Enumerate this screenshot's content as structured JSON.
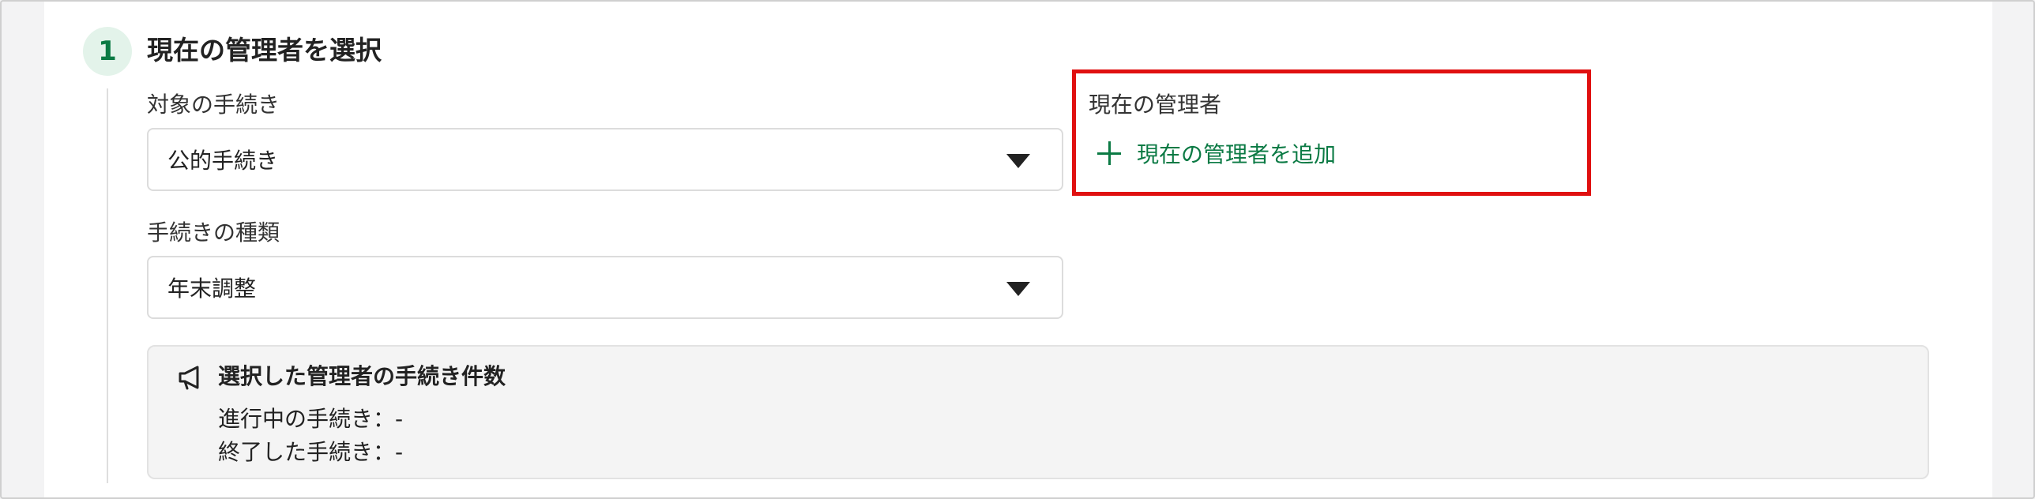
{
  "step": {
    "number": "1",
    "title": "現在の管理者を選択"
  },
  "procedure_target": {
    "label": "対象の手続き",
    "value": "公的手続き"
  },
  "procedure_type": {
    "label": "手続きの種類",
    "value": "年末調整"
  },
  "current_admin": {
    "label": "現在の管理者",
    "add_label": "現在の管理者を追加"
  },
  "summary": {
    "icon": "megaphone-icon",
    "title": "選択した管理者の手続き件数",
    "in_progress": "進行中の手続き：-",
    "completed": "終了した手続き：-"
  },
  "colors": {
    "accent_green": "#0b7a44",
    "badge_bg": "#e3f3ea",
    "highlight_red": "#e01010"
  }
}
